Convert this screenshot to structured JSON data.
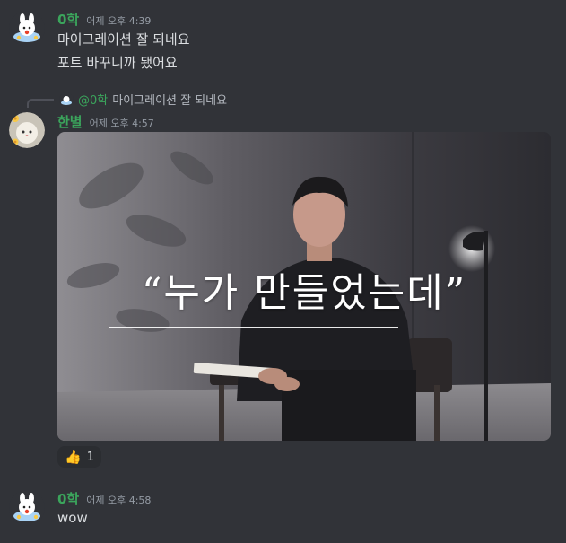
{
  "colors": {
    "background": "#313338",
    "username_green": "#3ba55c",
    "timestamp": "#949ba4",
    "text": "#dbdee1"
  },
  "messages": [
    {
      "author": "0학",
      "author_color": "#3ba55c",
      "timestamp": "어제 오후 4:39",
      "lines": [
        "마이그레이션 잘 되네요",
        "포트 바꾸니까 됐어요"
      ],
      "avatar_icon": "cloud-bunny-avatar-icon"
    },
    {
      "author": "한별",
      "author_color": "#3ba55c",
      "timestamp": "어제 오후 4:57",
      "avatar_icon": "flower-cat-avatar-icon",
      "reply": {
        "author": "@0학",
        "text": "마이그레이션 잘 되네요",
        "icon": "reply-mini-avatar-icon"
      },
      "embed": {
        "caption": "“누가 만들었는데”"
      },
      "reactions": [
        {
          "emoji": "👍",
          "emoji_name": "thumbs-up-icon",
          "count": "1"
        }
      ]
    },
    {
      "author": "0학",
      "author_color": "#3ba55c",
      "timestamp": "어제 오후 4:58",
      "lines": [
        "wow"
      ],
      "avatar_icon": "cloud-bunny-avatar-icon"
    }
  ]
}
